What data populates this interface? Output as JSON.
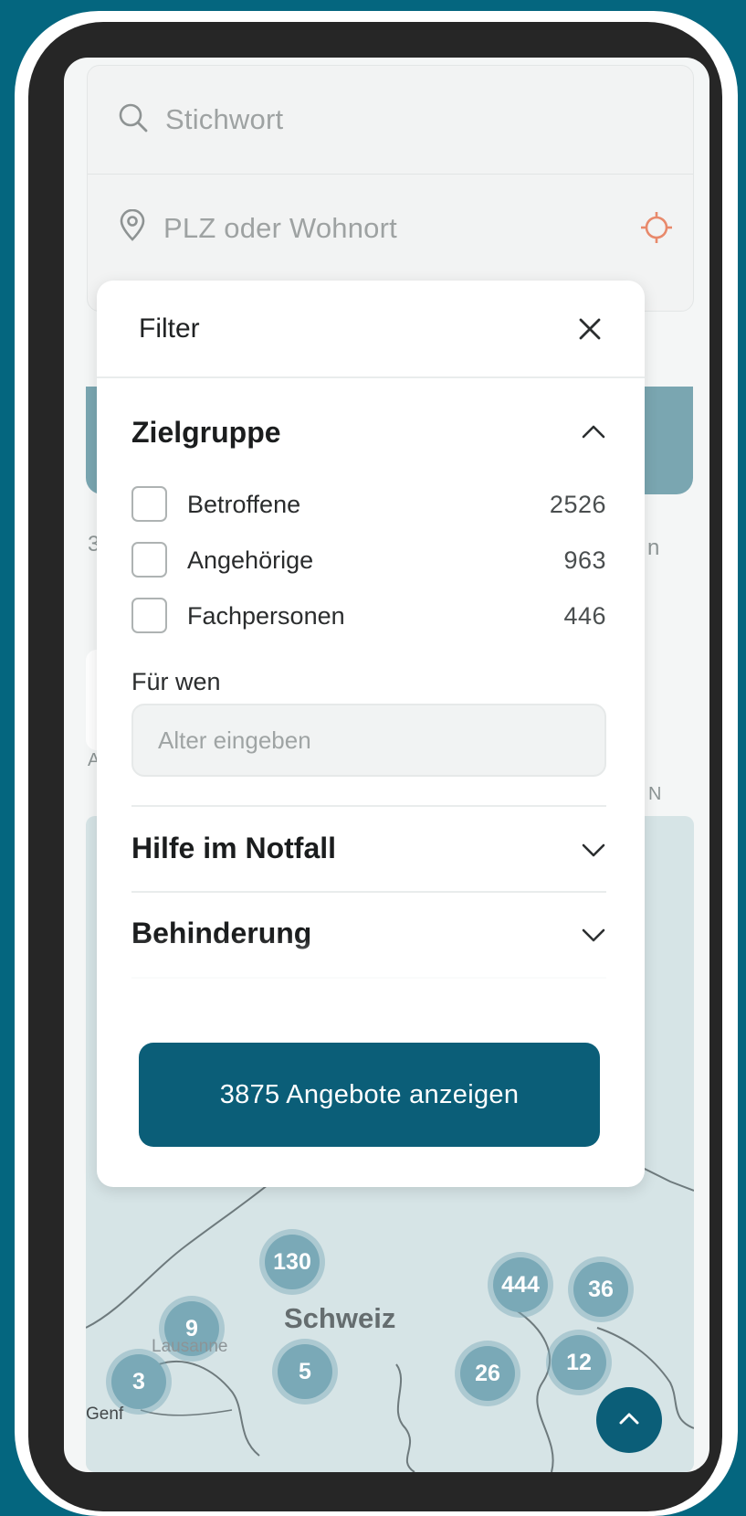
{
  "search": {
    "keyword_placeholder": "Stichwort",
    "location_placeholder": "PLZ oder Wohnort"
  },
  "background": {
    "count_fragment": "3",
    "right_fragment": "n",
    "map_marker_left": "A",
    "map_marker_right": "N"
  },
  "map": {
    "country_label": "Schweiz",
    "cities": [
      "Lausanne",
      "Genf"
    ],
    "clusters": [
      "130",
      "444",
      "36",
      "9",
      "5",
      "3",
      "26",
      "12"
    ]
  },
  "filter": {
    "title": "Filter",
    "sections": [
      {
        "title": "Zielgruppe",
        "expanded": true
      },
      {
        "title": "Hilfe im Notfall",
        "expanded": false
      },
      {
        "title": "Behinderung",
        "expanded": false
      }
    ],
    "target_groups": [
      {
        "label": "Betroffene",
        "count": "2526",
        "checked": false
      },
      {
        "label": "Angehörige",
        "count": "963",
        "checked": false
      },
      {
        "label": "Fachpersonen",
        "count": "446",
        "checked": false
      }
    ],
    "for_whom_label": "Für wen",
    "age_placeholder": "Alter eingeben",
    "submit_label": "3875 Angebote anzeigen"
  },
  "colors": {
    "page_background": "#04667f",
    "primary_button": "#0b5e78",
    "locate_accent": "#e8896b",
    "cluster": "#7aa9b7"
  }
}
